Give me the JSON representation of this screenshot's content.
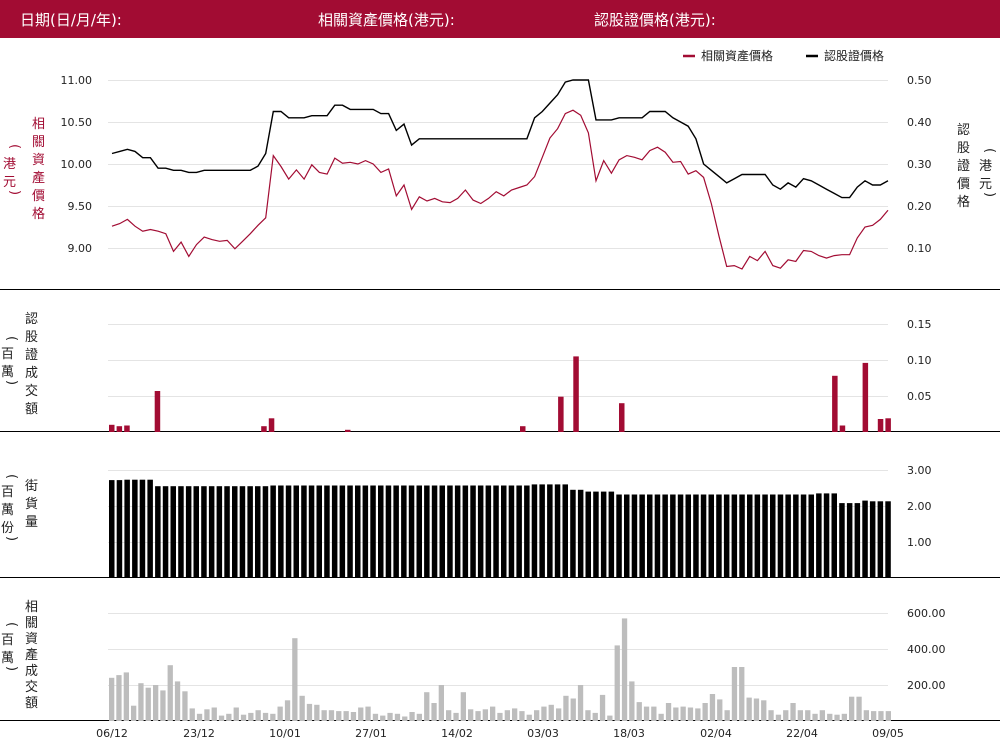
{
  "header": {
    "date_label": "日期(日/月/年):",
    "underlying_label": "相關資產價格(港元):",
    "warrant_label": "認股證價格(港元):"
  },
  "colors": {
    "brand": "#a20c33",
    "underlying": "#a20c33",
    "warrant": "#000000",
    "turnover": "#bdbdbd",
    "grid": "#e4e4e4"
  },
  "panels": {
    "price": {
      "ylabel_left": [
        "相",
        "關",
        "資",
        "產",
        "價",
        "格"
      ],
      "unit_left": [
        "(",
        "港",
        "元",
        ")"
      ],
      "ylabel_right": [
        "認",
        "股",
        "證",
        "價",
        "格"
      ],
      "unit_right": [
        "(",
        "港",
        "元",
        ")"
      ]
    },
    "warrant_turnover": {
      "ylabel": [
        "認",
        "股",
        "證",
        "成",
        "交",
        "額"
      ],
      "unit": [
        "(",
        "百",
        "萬",
        ")"
      ]
    },
    "outstanding": {
      "ylabel": [
        "街",
        "貨",
        "量"
      ],
      "unit": [
        "(",
        "百",
        "萬",
        "份",
        ")"
      ]
    },
    "underlying_turnover": {
      "ylabel": [
        "相",
        "關",
        "資",
        "產",
        "成",
        "交",
        "額"
      ],
      "unit": [
        "(",
        "百",
        "萬",
        ")"
      ]
    }
  },
  "chart_data": [
    {
      "type": "line",
      "legend": [
        "相關資產價格",
        "認股證價格"
      ],
      "legend_position": "top-right",
      "x_ticks": [
        "06/12",
        "23/12",
        "10/01",
        "27/01",
        "14/02",
        "03/03",
        "18/03",
        "02/04",
        "22/04",
        "09/05"
      ],
      "yleft_ticks": [
        "11.00",
        "10.50",
        "10.00",
        "9.50",
        "9.00"
      ],
      "yright_ticks": [
        "0.50",
        "0.40",
        "0.30",
        "0.20",
        "0.10"
      ],
      "ylim_left": [
        8.65,
        11.1
      ],
      "ylim_right": [
        0.025,
        0.52
      ],
      "series": [
        {
          "name": "相關資產價格",
          "axis": "left",
          "values": [
            9.26,
            9.29,
            9.34,
            9.26,
            9.2,
            9.22,
            9.2,
            9.17,
            8.96,
            9.07,
            8.9,
            9.04,
            9.13,
            9.1,
            9.08,
            9.09,
            8.99,
            9.08,
            9.17,
            9.27,
            9.36,
            10.1,
            9.97,
            9.82,
            9.93,
            9.82,
            9.99,
            9.9,
            9.88,
            10.07,
            10.01,
            10.02,
            10.0,
            10.04,
            10.0,
            9.9,
            9.94,
            9.62,
            9.75,
            9.46,
            9.61,
            9.56,
            9.59,
            9.55,
            9.54,
            9.59,
            9.69,
            9.57,
            9.53,
            9.59,
            9.67,
            9.62,
            9.69,
            9.72,
            9.75,
            9.85,
            10.08,
            10.31,
            10.42,
            10.6,
            10.64,
            10.58,
            10.37,
            9.8,
            10.04,
            9.89,
            10.05,
            10.1,
            10.08,
            10.05,
            10.16,
            10.2,
            10.14,
            10.02,
            10.03,
            9.88,
            9.92,
            9.84,
            9.53,
            9.14,
            8.78,
            8.79,
            8.75,
            8.9,
            8.85,
            8.96,
            8.79,
            8.76,
            8.86,
            8.84,
            8.97,
            8.96,
            8.91,
            8.88,
            8.91,
            8.92,
            8.92,
            9.12,
            9.25,
            9.27,
            9.34,
            9.45
          ]
        },
        {
          "name": "認股證價格",
          "axis": "right",
          "values": [
            0.325,
            0.33,
            0.335,
            0.33,
            0.315,
            0.315,
            0.29,
            0.29,
            0.285,
            0.285,
            0.28,
            0.28,
            0.285,
            0.285,
            0.285,
            0.285,
            0.285,
            0.285,
            0.285,
            0.295,
            0.325,
            0.425,
            0.425,
            0.41,
            0.41,
            0.41,
            0.415,
            0.415,
            0.415,
            0.44,
            0.44,
            0.43,
            0.43,
            0.43,
            0.43,
            0.42,
            0.42,
            0.38,
            0.395,
            0.345,
            0.36,
            0.36,
            0.36,
            0.36,
            0.36,
            0.36,
            0.36,
            0.36,
            0.36,
            0.36,
            0.36,
            0.36,
            0.36,
            0.36,
            0.36,
            0.41,
            0.425,
            0.445,
            0.465,
            0.495,
            0.5,
            0.5,
            0.5,
            0.405,
            0.405,
            0.405,
            0.41,
            0.41,
            0.41,
            0.41,
            0.425,
            0.425,
            0.425,
            0.41,
            0.4,
            0.39,
            0.36,
            0.3,
            0.285,
            0.27,
            0.255,
            0.265,
            0.275,
            0.275,
            0.275,
            0.275,
            0.25,
            0.24,
            0.255,
            0.245,
            0.265,
            0.26,
            0.25,
            0.24,
            0.23,
            0.22,
            0.22,
            0.245,
            0.26,
            0.25,
            0.25,
            0.26
          ]
        }
      ]
    },
    {
      "type": "bar",
      "ylabel": "認股證成交額",
      "y_ticks": [
        "0.15",
        "0.10",
        "0.05"
      ],
      "ylim": [
        0,
        0.175
      ],
      "color": "#a20c33",
      "values": [
        0.01,
        0.008,
        0.009,
        0,
        0,
        0,
        0.057,
        0,
        0,
        0,
        0,
        0,
        0,
        0,
        0,
        0,
        0,
        0,
        0,
        0,
        0.008,
        0.019,
        0,
        0,
        0,
        0,
        0,
        0,
        0,
        0,
        0,
        0.003,
        0,
        0,
        0,
        0,
        0,
        0,
        0,
        0,
        0,
        0,
        0,
        0,
        0,
        0,
        0,
        0,
        0,
        0,
        0,
        0,
        0,
        0,
        0.008,
        0,
        0,
        0,
        0,
        0.049,
        0,
        0.105,
        0,
        0,
        0,
        0,
        0,
        0.04,
        0,
        0,
        0,
        0,
        0,
        0,
        0,
        0,
        0,
        0,
        0,
        0,
        0,
        0,
        0,
        0,
        0,
        0,
        0,
        0,
        0,
        0,
        0,
        0,
        0,
        0,
        0,
        0.078,
        0.009,
        0,
        0,
        0.096,
        0,
        0.018,
        0.019
      ]
    },
    {
      "type": "bar",
      "ylabel": "街貨量",
      "y_ticks": [
        "3.00",
        "2.00",
        "1.00"
      ],
      "ylim": [
        0,
        3.3
      ],
      "color": "#000000",
      "values": [
        2.72,
        2.72,
        2.73,
        2.73,
        2.73,
        2.73,
        2.55,
        2.55,
        2.55,
        2.55,
        2.55,
        2.55,
        2.55,
        2.55,
        2.55,
        2.55,
        2.55,
        2.55,
        2.55,
        2.55,
        2.55,
        2.57,
        2.57,
        2.57,
        2.57,
        2.57,
        2.57,
        2.57,
        2.57,
        2.57,
        2.57,
        2.57,
        2.57,
        2.57,
        2.57,
        2.57,
        2.57,
        2.57,
        2.57,
        2.57,
        2.57,
        2.57,
        2.57,
        2.57,
        2.57,
        2.57,
        2.57,
        2.57,
        2.57,
        2.57,
        2.57,
        2.57,
        2.57,
        2.57,
        2.57,
        2.6,
        2.6,
        2.6,
        2.6,
        2.6,
        2.45,
        2.45,
        2.4,
        2.4,
        2.4,
        2.4,
        2.32,
        2.32,
        2.32,
        2.32,
        2.32,
        2.32,
        2.32,
        2.32,
        2.32,
        2.32,
        2.32,
        2.32,
        2.32,
        2.32,
        2.32,
        2.32,
        2.32,
        2.32,
        2.32,
        2.32,
        2.32,
        2.32,
        2.32,
        2.32,
        2.32,
        2.32,
        2.35,
        2.35,
        2.35,
        2.08,
        2.08,
        2.08,
        2.15,
        2.13,
        2.13,
        2.13
      ]
    },
    {
      "type": "bar",
      "ylabel": "相關資產成交額",
      "y_ticks": [
        "600.00",
        "400.00",
        "200.00"
      ],
      "ylim": [
        0,
        660
      ],
      "color": "#bdbdbd",
      "values": [
        240,
        255,
        270,
        85,
        210,
        185,
        200,
        170,
        310,
        220,
        165,
        70,
        40,
        65,
        75,
        30,
        40,
        75,
        35,
        45,
        60,
        45,
        40,
        80,
        115,
        460,
        140,
        95,
        90,
        60,
        60,
        55,
        55,
        50,
        75,
        80,
        40,
        30,
        45,
        40,
        25,
        50,
        40,
        160,
        100,
        200,
        60,
        45,
        160,
        65,
        55,
        65,
        80,
        45,
        60,
        70,
        55,
        35,
        60,
        80,
        90,
        70,
        140,
        125,
        200,
        60,
        45,
        145,
        30,
        420,
        570,
        220,
        105,
        80,
        80,
        40,
        100,
        75,
        80,
        75,
        70,
        100,
        150,
        120,
        60,
        300,
        300,
        130,
        125,
        115,
        60,
        35,
        60,
        100,
        60,
        60,
        40,
        60,
        40,
        35,
        40,
        135,
        135,
        60,
        55,
        55,
        55
      ]
    }
  ]
}
